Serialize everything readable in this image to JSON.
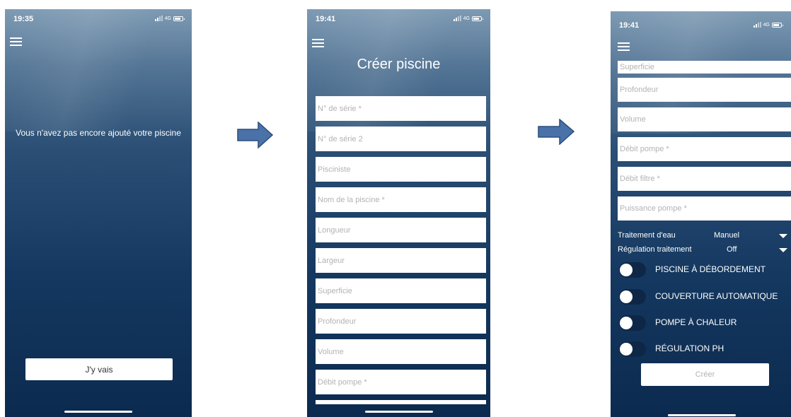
{
  "colors": {
    "arrow_fill": "#4a72a8",
    "arrow_stroke": "#2c4f7c",
    "field_placeholder": "#b3b3b3"
  },
  "screen1": {
    "time": "19:35",
    "network": "4G",
    "message": "Vous n'avez pas encore ajouté votre piscine",
    "button": "J'y vais"
  },
  "screen2": {
    "time": "19:41",
    "network": "4G",
    "title": "Créer piscine",
    "fields": [
      "N° de série *",
      "N° de série 2",
      "Pisciniste",
      "Nom de la piscine *",
      "Longueur",
      "Largeur",
      "Superficie",
      "Profondeur",
      "Volume",
      "Débit pompe *"
    ]
  },
  "screen3": {
    "time": "19:41",
    "network": "4G",
    "fields": [
      "Superficie",
      "Profondeur",
      "Volume",
      "Débit pompe *",
      "Débit filtre *",
      "Puissance pompe *"
    ],
    "water_treatment": {
      "label": "Traitement d'eau",
      "value": "Manuel"
    },
    "treatment_regulation": {
      "label": "Régulation traitement",
      "value": "Off"
    },
    "toggles": [
      {
        "label": "PISCINE À DÉBORDEMENT",
        "on": false
      },
      {
        "label": "COUVERTURE AUTOMATIQUE",
        "on": false
      },
      {
        "label": "POMPE À CHALEUR",
        "on": false
      },
      {
        "label": "RÉGULATION PH",
        "on": false
      }
    ],
    "create_button": "Créer"
  }
}
